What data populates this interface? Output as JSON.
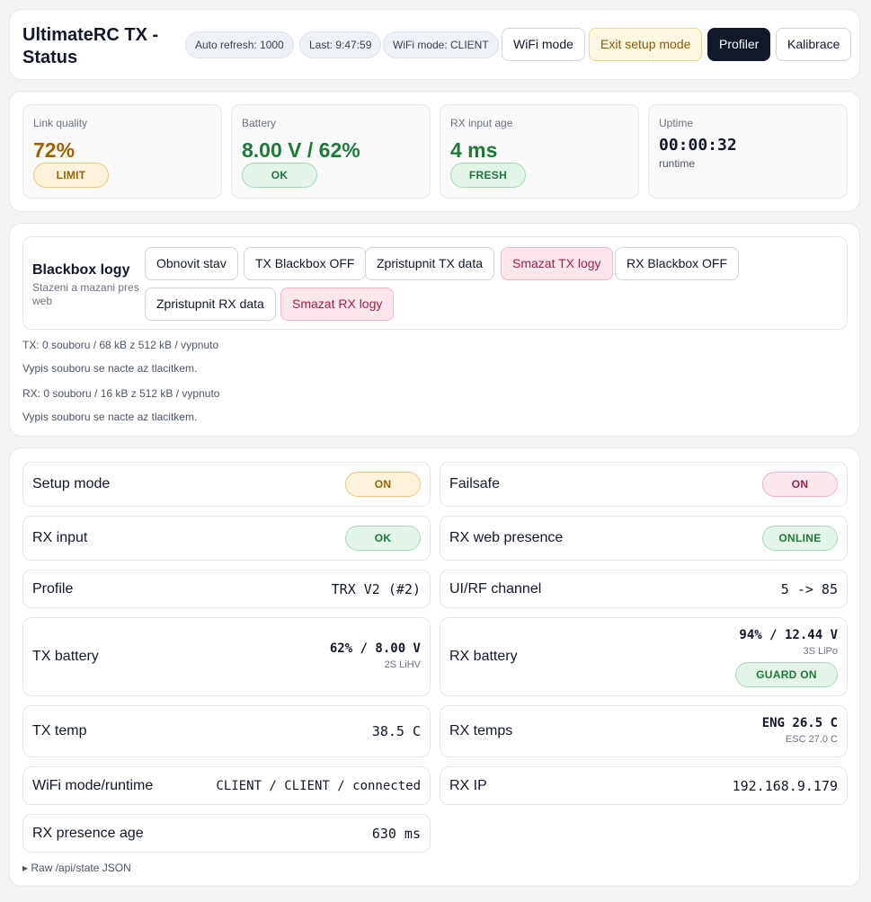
{
  "header": {
    "title": "UltimateRC TX - Status",
    "auto_refresh": "Auto refresh: 1000",
    "last": "Last: 9:47:59",
    "wifi_mode": "WiFi mode: CLIENT",
    "buttons": {
      "wifi_mode": "WiFi mode",
      "exit_setup": "Exit setup mode",
      "profiler": "Profiler",
      "kalibrace": "Kalibrace"
    }
  },
  "stats": [
    {
      "label": "Link quality",
      "value": "72%",
      "badge": "LIMIT",
      "color": "#9a6400"
    },
    {
      "label": "Battery",
      "value": "8.00 V / 62%",
      "badge": "OK",
      "color": "#1f7a3a"
    },
    {
      "label": "RX input age",
      "value": "4 ms",
      "badge": "FRESH",
      "color": "#1f7a3a"
    },
    {
      "label": "Uptime",
      "value": "00:00:32",
      "sub": "runtime",
      "color": "#111827"
    }
  ],
  "blackbox": {
    "title": "Blackbox logy",
    "desc": "Stazeni a mazani pres web",
    "buttons": {
      "refresh": "Obnovit stav",
      "tx_off": "TX Blackbox OFF",
      "tx_data": "Zpristupnit TX data",
      "tx_delete": "Smazat TX logy",
      "rx_off": "RX Blackbox OFF",
      "rx_data": "Zpristupnit RX data",
      "rx_delete": "Smazat RX logy"
    },
    "tx_info": "TX: 0 souboru / 68 kB z 512 kB / vypnuto",
    "tx_note": "Vypis souboru se nacte az tlacitkem.",
    "rx_info": "RX: 0 souboru / 16 kB z 512 kB / vypnuto",
    "rx_note": "Vypis souboru se nacte az tlacitkem."
  },
  "status": {
    "setup_mode": {
      "label": "Setup mode",
      "value": "ON"
    },
    "failsafe": {
      "label": "Failsafe",
      "value": "ON"
    },
    "rx_input": {
      "label": "RX input",
      "value": "OK"
    },
    "rx_web": {
      "label": "RX web presence",
      "value": "ONLINE"
    },
    "profile": {
      "label": "Profile",
      "value": "TRX V2 (#2)"
    },
    "channel": {
      "label": "UI/RF channel",
      "value": "5 -> 85"
    },
    "tx_battery": {
      "label": "TX battery",
      "value": "62% / 8.00 V",
      "sub": "2S LiHV"
    },
    "rx_battery": {
      "label": "RX battery",
      "value": "94% / 12.44 V",
      "sub": "3S LiPo",
      "badge": "GUARD ON"
    },
    "tx_temp": {
      "label": "TX temp",
      "value": "38.5 C"
    },
    "rx_temps": {
      "label": "RX temps",
      "value": "ENG 26.5 C",
      "sub": "ESC 27.0 C"
    },
    "wifi_runtime": {
      "label": "WiFi mode/runtime",
      "value": "CLIENT / CLIENT / connected"
    },
    "rx_ip": {
      "label": "RX IP",
      "value": "192.168.9.179"
    },
    "rx_presence_age": {
      "label": "RX presence age",
      "value": "630 ms"
    }
  },
  "raw_json": "▸ Raw /api/state JSON"
}
